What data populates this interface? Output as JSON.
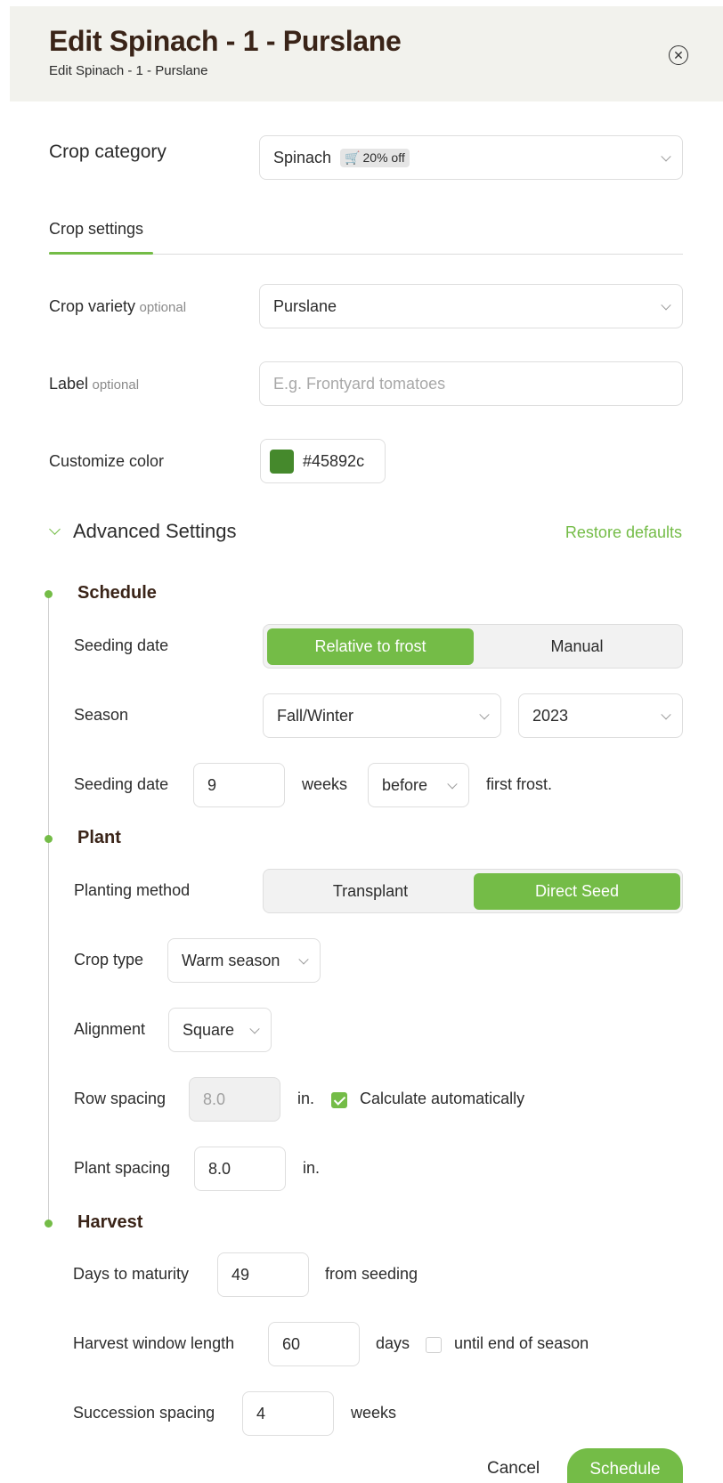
{
  "header": {
    "title": "Edit Spinach - 1 - Purslane",
    "subtitle": "Edit Spinach - 1 - Purslane",
    "close_icon": "close-circle-icon"
  },
  "crop_category": {
    "label": "Crop category",
    "value": "Spinach",
    "badge": "20% off",
    "badge_icon": "cart-icon"
  },
  "tabs": [
    {
      "label": "Crop settings",
      "active": true
    }
  ],
  "crop_variety": {
    "label": "Crop variety",
    "optional": "optional",
    "value": "Purslane"
  },
  "label_field": {
    "label": "Label",
    "optional": "optional",
    "placeholder": "E.g. Frontyard tomatoes",
    "value": ""
  },
  "customize_color": {
    "label": "Customize color",
    "value": "#45892c"
  },
  "advanced": {
    "title": "Advanced Settings",
    "restore": "Restore defaults",
    "expanded": true
  },
  "schedule": {
    "title": "Schedule",
    "seeding_mode": {
      "label": "Seeding date",
      "options": [
        "Relative to frost",
        "Manual"
      ],
      "selected": "Relative to frost"
    },
    "season": {
      "label": "Season",
      "season_value": "Fall/Winter",
      "year_value": "2023"
    },
    "seeding_date": {
      "label": "Seeding date",
      "weeks": "9",
      "weeks_unit": "weeks",
      "relation": "before",
      "suffix": "first frost."
    }
  },
  "plant": {
    "title": "Plant",
    "planting_method": {
      "label": "Planting method",
      "options": [
        "Transplant",
        "Direct Seed"
      ],
      "selected": "Direct Seed"
    },
    "crop_type": {
      "label": "Crop type",
      "value": "Warm season"
    },
    "alignment": {
      "label": "Alignment",
      "value": "Square"
    },
    "row_spacing": {
      "label": "Row spacing",
      "value": "8.0",
      "unit": "in.",
      "auto_label": "Calculate automatically",
      "auto_checked": true
    },
    "plant_spacing": {
      "label": "Plant spacing",
      "value": "8.0",
      "unit": "in."
    }
  },
  "harvest": {
    "title": "Harvest",
    "days_to_maturity": {
      "label": "Days to maturity",
      "value": "49",
      "suffix": "from seeding"
    },
    "window_length": {
      "label": "Harvest window length",
      "value": "60",
      "unit": "days",
      "end_label": "until end of season",
      "end_checked": false
    },
    "succession": {
      "label": "Succession spacing",
      "value": "4",
      "unit": "weeks"
    }
  },
  "footer": {
    "cancel": "Cancel",
    "schedule": "Schedule"
  },
  "colors": {
    "accent": "#74bc47",
    "heading": "#3a2418",
    "swatch": "#45892c"
  }
}
